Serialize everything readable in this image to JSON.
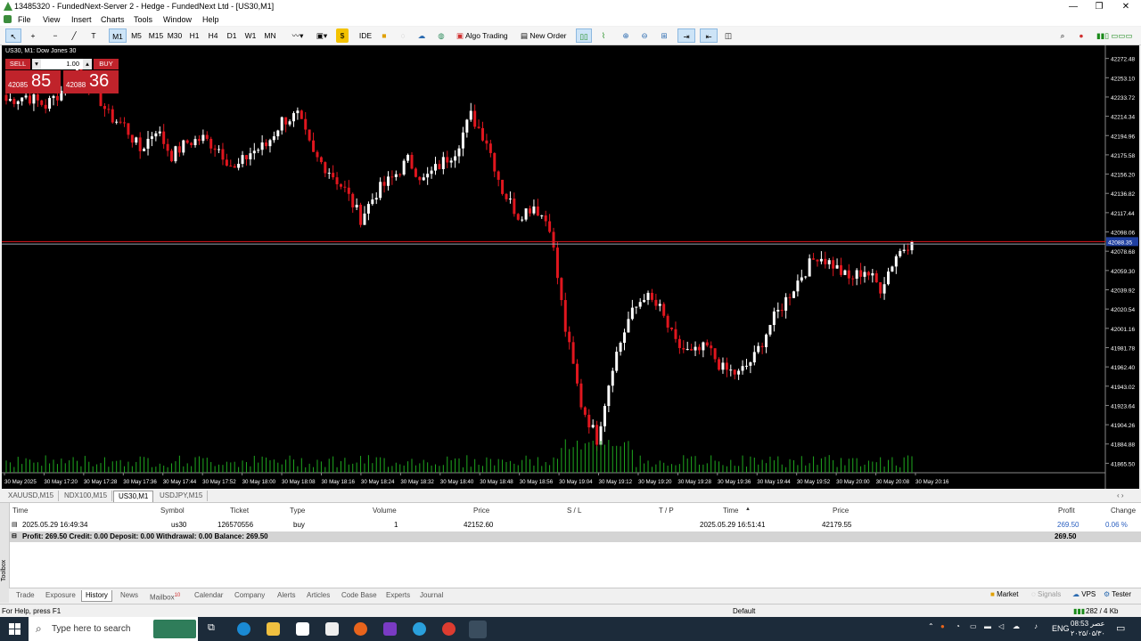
{
  "window": {
    "title": "13485320 - FundedNext-Server 2 - Hedge - FundedNext Ltd - [US30,M1]",
    "minimize": "—",
    "restore": "❐",
    "close": "✕"
  },
  "menu": [
    "File",
    "View",
    "Insert",
    "Charts",
    "Tools",
    "Window",
    "Help"
  ],
  "toolbar": {
    "timeframes": [
      "M1",
      "M5",
      "M15",
      "M30",
      "H1",
      "H4",
      "D1",
      "W1",
      "MN"
    ],
    "active_timeframe": "M1",
    "ide": "IDE",
    "algo_trading": "Algo Trading",
    "new_order": "New Order"
  },
  "chart": {
    "symbol_label": "US30, M1:  Dow Jones 30",
    "sell": "SELL",
    "buy": "BUY",
    "volume": "1.00",
    "bid_small": "42085",
    "bid_big": "85",
    "ask_small": "42088",
    "ask_big": "36",
    "current_price_label": "42088.35"
  },
  "chart_data": {
    "type": "candlestick",
    "y_ticks": [
      "42272.48",
      "42253.10",
      "42233.72",
      "42214.34",
      "42194.96",
      "42175.58",
      "42156.20",
      "42136.82",
      "42117.44",
      "42098.06",
      "42078.68",
      "42059.30",
      "42039.92",
      "42020.54",
      "42001.16",
      "41981.78",
      "41962.40",
      "41943.02",
      "41923.64",
      "41904.26",
      "41884.88",
      "41865.50"
    ],
    "ylim": [
      41856,
      42282
    ],
    "x_ticks": [
      "30 May 2025",
      "30 May 17:20",
      "30 May 17:28",
      "30 May 17:36",
      "30 May 17:44",
      "30 May 17:52",
      "30 May 18:00",
      "30 May 18:08",
      "30 May 18:16",
      "30 May 18:24",
      "30 May 18:32",
      "30 May 18:40",
      "30 May 18:48",
      "30 May 18:56",
      "30 May 19:04",
      "30 May 19:12",
      "30 May 19:20",
      "30 May 19:28",
      "30 May 19:36",
      "30 May 19:44",
      "30 May 19:52",
      "30 May 20:00",
      "30 May 20:08",
      "30 May 20:16"
    ],
    "current_price": 42088.35,
    "bid_line": 42085.85,
    "close_path": [
      [
        0,
        42230
      ],
      [
        5,
        42235
      ],
      [
        10,
        42225
      ],
      [
        14,
        42240
      ],
      [
        18,
        42262
      ],
      [
        22,
        42245
      ],
      [
        26,
        42215
      ],
      [
        30,
        42205
      ],
      [
        34,
        42180
      ],
      [
        38,
        42202
      ],
      [
        42,
        42175
      ],
      [
        46,
        42188
      ],
      [
        50,
        42192
      ],
      [
        54,
        42182
      ],
      [
        58,
        42160
      ],
      [
        62,
        42178
      ],
      [
        66,
        42185
      ],
      [
        70,
        42210
      ],
      [
        74,
        42215
      ],
      [
        78,
        42175
      ],
      [
        82,
        42160
      ],
      [
        86,
        42140
      ],
      [
        90,
        42112
      ],
      [
        94,
        42138
      ],
      [
        98,
        42152
      ],
      [
        102,
        42170
      ],
      [
        106,
        42150
      ],
      [
        110,
        42165
      ],
      [
        114,
        42180
      ],
      [
        118,
        42215
      ],
      [
        122,
        42190
      ],
      [
        126,
        42140
      ],
      [
        130,
        42115
      ],
      [
        134,
        42125
      ],
      [
        138,
        42105
      ],
      [
        142,
        42000
      ],
      [
        146,
        41925
      ],
      [
        150,
        41890
      ],
      [
        154,
        41965
      ],
      [
        158,
        42010
      ],
      [
        162,
        42035
      ],
      [
        166,
        42020
      ],
      [
        170,
        41985
      ],
      [
        174,
        41975
      ],
      [
        178,
        41982
      ],
      [
        182,
        41960
      ],
      [
        186,
        41955
      ],
      [
        190,
        41972
      ],
      [
        194,
        42005
      ],
      [
        198,
        42030
      ],
      [
        202,
        42055
      ],
      [
        206,
        42075
      ],
      [
        210,
        42065
      ],
      [
        214,
        42050
      ],
      [
        218,
        42060
      ],
      [
        222,
        42042
      ],
      [
        226,
        42075
      ],
      [
        230,
        42090
      ]
    ]
  },
  "chart_tabs": [
    "XAUUSD,M15",
    "NDX100,M15",
    "US30,M1",
    "USDJPY,M15"
  ],
  "active_chart_tab": "US30,M1",
  "terminal": {
    "headers": [
      "Time",
      "Symbol",
      "Ticket",
      "Type",
      "Volume",
      "Price",
      "S / L",
      "T / P",
      "Time",
      "Price",
      "Profit",
      "Change"
    ],
    "rows": [
      {
        "time": "2025.05.29 16:49:34",
        "symbol": "us30",
        "ticket": "126570556",
        "type": "buy",
        "volume": "1",
        "price": "42152.60",
        "sl": "",
        "tp": "",
        "time2": "2025.05.29 16:51:41",
        "price2": "42179.55",
        "profit": "269.50",
        "change": "0.06 %"
      }
    ],
    "balance_line": "Profit: 269.50  Credit: 0.00  Deposit: 0.00  Withdrawal: 0.00  Balance: 269.50",
    "balance_total": "269.50"
  },
  "bottom_tabs": [
    "Trade",
    "Exposure",
    "History",
    "News",
    "Mailbox",
    "Calendar",
    "Company",
    "Alerts",
    "Articles",
    "Code Base",
    "Experts",
    "Journal"
  ],
  "mailbox_badge": "10",
  "active_bottom_tab": "History",
  "right_tabs": [
    "Market",
    "Signals",
    "VPS",
    "Tester"
  ],
  "toolbox_label": "Toolbox",
  "status": {
    "help": "For Help, press F1",
    "profile": "Default",
    "traffic": "282 / 4 Kb"
  },
  "taskbar": {
    "search_placeholder": "Type here to search",
    "lang": "ENG",
    "time": "08:53 عصر",
    "date": "۲۰۲۵/۰۵/۳۰"
  },
  "colors": {
    "bear": "#e0161e",
    "bull": "#ffffff",
    "volume": "#1fa81f",
    "grid_bg": "#000000"
  }
}
